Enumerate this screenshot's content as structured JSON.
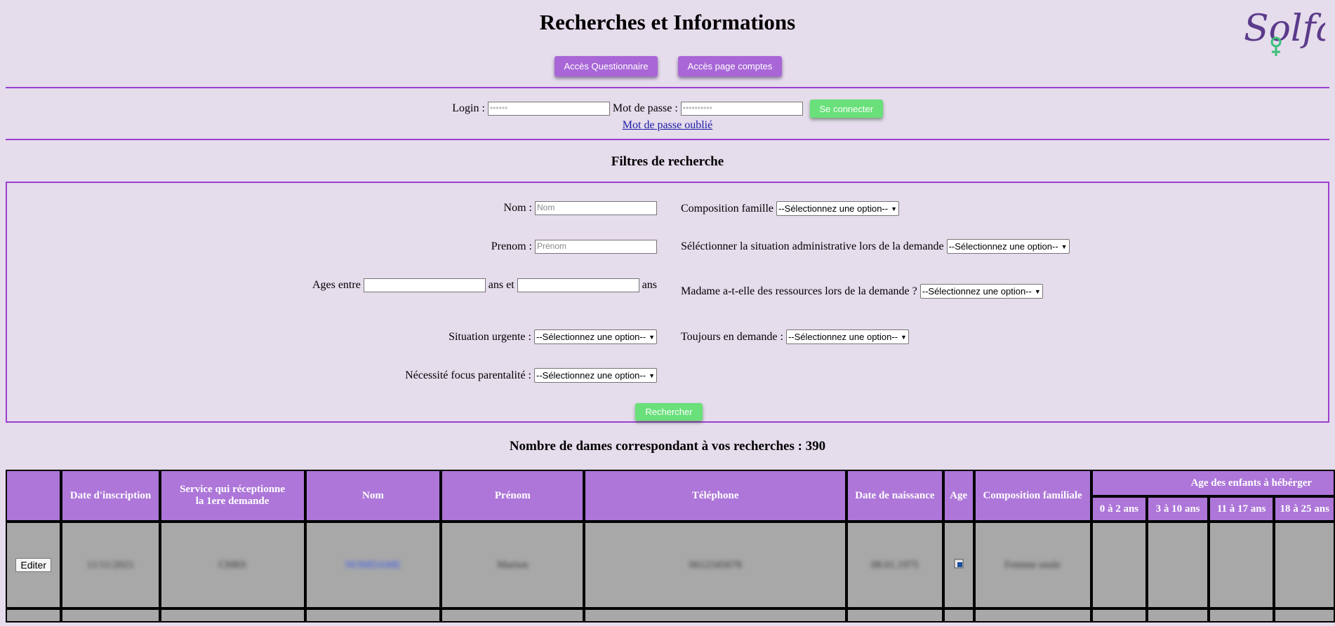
{
  "header": {
    "title": "Recherches et Informations",
    "logo_text": "Solfa",
    "btn_questionnaire": "Accès Questionnaire",
    "btn_comptes": "Accès page comptes"
  },
  "login": {
    "login_label": "Login :",
    "login_value": "••••••",
    "password_label": "Mot de passe :",
    "password_value": "••••••••••",
    "connect_button": "Se connecter",
    "forgot_link": "Mot de passe oublié"
  },
  "filters": {
    "title": "Filtres de recherche",
    "nom_label": "Nom :",
    "nom_placeholder": "Nom",
    "prenom_label": "Prenom :",
    "prenom_placeholder": "Prénom",
    "ages_label": "Ages entre",
    "ages_and": "ans et",
    "ages_suffix": "ans",
    "urgent_label": "Situation urgente :",
    "focus_label": "Nécessité focus parentalité :",
    "composition_label": "Composition famille",
    "admin_label": "Séléctionner la situation administrative lors de la demande",
    "ressources_label": "Madame a-t-elle des ressources lors de la demande ?",
    "demande_label": "Toujours en demande :",
    "select_default": "--Sélectionnez une option--",
    "search_button": "Rechercher"
  },
  "results": {
    "count_text": "Nombre de dames correspondant à vos recherches : 390",
    "headers": {
      "date_inscription": "Date d'inscription",
      "service_1": "Service qui réceptionne",
      "service_2": "la 1ere demande",
      "nom": "Nom",
      "prenom": "Prénom",
      "telephone": "Téléphone",
      "date_naissance": "Date de naissance",
      "age": "Age",
      "composition": "Composition familiale",
      "enfants": "Age des enfants à hébérger",
      "sub_0_2": "0 à 2 ans",
      "sub_3_10": "3 à 10 ans",
      "sub_11_17": "11 à 17 ans",
      "sub_18_25": "18 à 25 ans"
    },
    "row": {
      "edit_button": "Editer",
      "date_inscription": "11/11/2021",
      "service": "CHRS",
      "nom": "NOMDAME",
      "prenom": "Marion",
      "telephone": "0612345678",
      "date_naissance": "08.01.1975",
      "composition": "Femme seule"
    }
  },
  "colors": {
    "background": "#e5dcec",
    "accent_purple": "#a866d6",
    "border_purple": "#9b3fd0",
    "green_button": "#69e07a",
    "table_header": "#ad76d8",
    "table_cell": "#a8a8a8"
  }
}
